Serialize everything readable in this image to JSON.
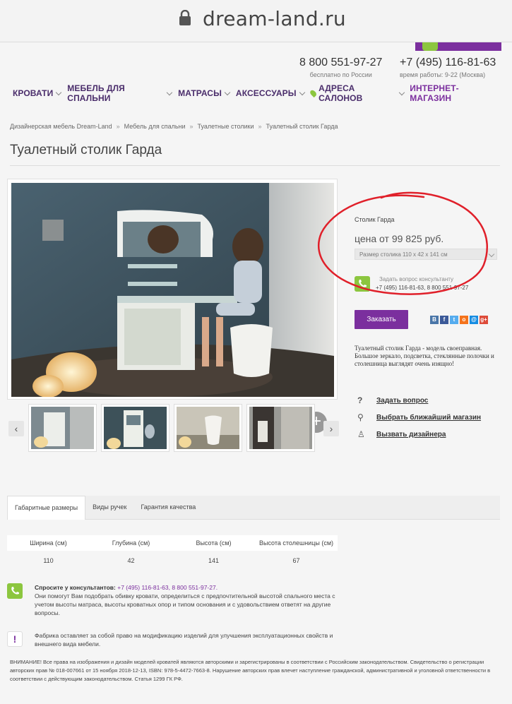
{
  "browser": {
    "url": "dream-land.ru"
  },
  "header": {
    "phone1": {
      "number": "8 800 551-97-27",
      "note": "бесплатно по России"
    },
    "phone2": {
      "number": "+7 (495) 116-81-63",
      "note": "время работы: 9-22 (Москва)"
    }
  },
  "menu": [
    {
      "label": "КРОВАТИ"
    },
    {
      "label": "МЕБЕЛЬ ДЛЯ СПАЛЬНИ"
    },
    {
      "label": "МАТРАСЫ"
    },
    {
      "label": "АКСЕССУАРЫ"
    },
    {
      "label": "АДРЕСА САЛОНОВ"
    },
    {
      "label": "ИНТЕРНЕТ-МАГАЗИН"
    }
  ],
  "breadcrumbs": [
    "Дизайнерская мебель Dream-Land",
    "Мебель для спальни",
    "Туалетные столики",
    "Туалетный столик Гарда"
  ],
  "page_title": "Туалетный столик Гарда",
  "product": {
    "name": "Столик Гарда",
    "price": "цена от 99 825 руб.",
    "size_option": "Размер столика 110 x 42 x 141 см",
    "consult_question": "Задать вопрос консультанту",
    "consult_phones": "+7 (495) 116-81-63, 8 800 551-97-27",
    "order_label": "Заказать",
    "description": "Туалетный столик Гарда - модель своеправная. Большое зеркало, подсветка, стеклянные полочки и столешница выглядят очень изящно!"
  },
  "socials": [
    {
      "label": "В",
      "color": "#4a76a8"
    },
    {
      "label": "f",
      "color": "#3b5998"
    },
    {
      "label": "t",
      "color": "#55acee"
    },
    {
      "label": "о",
      "color": "#f4731c"
    },
    {
      "label": "@",
      "color": "#168de2"
    },
    {
      "label": "g+",
      "color": "#dd4b39"
    }
  ],
  "actions": [
    {
      "icon": "?",
      "label": "Задать вопрос"
    },
    {
      "icon": "⚲",
      "label": "Выбрать ближайший магазин"
    },
    {
      "icon": "♙",
      "label": "Вызвать дизайнера"
    }
  ],
  "tabs": [
    "Габаритные размеры",
    "Виды ручек",
    "Гарантия качества"
  ],
  "dimensions": {
    "headers": [
      "Ширина (см)",
      "Глубина (см)",
      "Высота (см)",
      "Высота столешницы (см)"
    ],
    "values": [
      "110",
      "42",
      "141",
      "67"
    ]
  },
  "notes": {
    "consult_title": "Спросите у консультантов:",
    "consult_phones": "+7 (495) 116-81-63, 8 800 551-97-27.",
    "consult_text": "Они помогут Вам подобрать обивку кровати, определиться с предпочтительной высотой спального места с учетом высоты матраса, высоты кроватных опор и типом основания и с удовольствием ответят на другие вопросы.",
    "factory_text": "Фабрика оставляет за собой право на модификацию изделий для улучшения эксплуатационных свойств и внешнего вида мебели."
  },
  "warning": "ВНИМАНИЕ! Все права на изображения и дизайн моделей кроватей являются авторскими и зарегистрированы в соответствии с Российским законодательством. Свидетельство о регистрации авторских прав № 018-007661 от 15 ноября 2018-12-13, ISBN: 978-5-4472-7663-8. Нарушение авторских прав влечет наступление гражданской, административной и уголовной ответственности в соответствии с действующим законодательством. Статья 1299 ГК РФ.",
  "colors": {
    "brand": "#7b2f9e",
    "accent": "#8cc63f",
    "annotation": "#e0202a"
  }
}
